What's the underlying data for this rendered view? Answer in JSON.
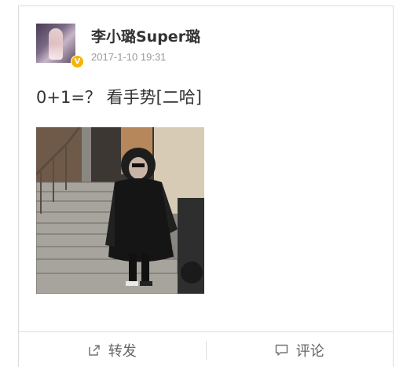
{
  "post": {
    "author": "李小璐Super璐",
    "verified_badge": "V",
    "verified_color": "#f7b400",
    "timestamp": "2017-1-10 19:31",
    "text": "0+1=？ 看手势[二哈]"
  },
  "actions": {
    "repost_label": "转发",
    "repost_icon": "share-arrow-icon",
    "comment_label": "评论",
    "comment_icon": "comment-bubble-icon"
  }
}
